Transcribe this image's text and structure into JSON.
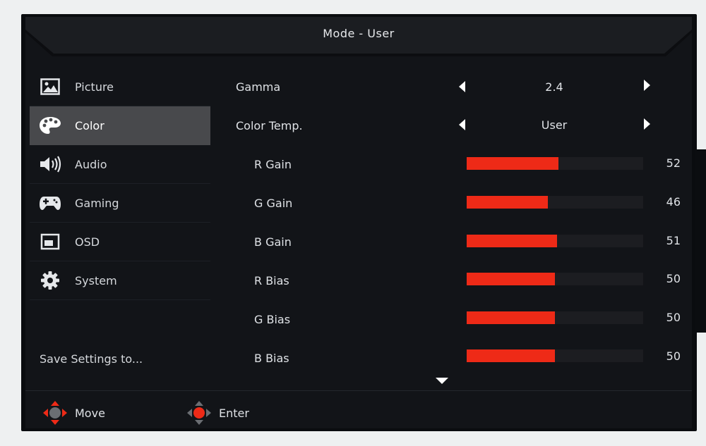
{
  "header": {
    "title": "Mode - User"
  },
  "sidebar": {
    "items": [
      {
        "label": "Picture",
        "icon": "picture-icon",
        "active": false
      },
      {
        "label": "Color",
        "icon": "palette-icon",
        "active": true
      },
      {
        "label": "Audio",
        "icon": "speaker-icon",
        "active": false
      },
      {
        "label": "Gaming",
        "icon": "gamepad-icon",
        "active": false
      },
      {
        "label": "OSD",
        "icon": "osd-window-icon",
        "active": false
      },
      {
        "label": "System",
        "icon": "gear-icon",
        "active": false
      }
    ],
    "save_label": "Save Settings to..."
  },
  "settings": {
    "gamma": {
      "label": "Gamma",
      "value": "2.4"
    },
    "color_temp": {
      "label": "Color Temp.",
      "value": "User"
    },
    "sliders": [
      {
        "label": "R Gain",
        "value": 52,
        "fill": 52
      },
      {
        "label": "G Gain",
        "value": 46,
        "fill": 46
      },
      {
        "label": "B Gain",
        "value": 51,
        "fill": 51
      },
      {
        "label": "R Bias",
        "value": 50,
        "fill": 50
      },
      {
        "label": "G Bias",
        "value": 50,
        "fill": 50
      },
      {
        "label": "B Bias",
        "value": 50,
        "fill": 50
      }
    ]
  },
  "footer": {
    "move_label": "Move",
    "enter_label": "Enter"
  },
  "colors": {
    "accent": "#ee2a17",
    "panel": "#121418",
    "active_item": "#48494c"
  }
}
